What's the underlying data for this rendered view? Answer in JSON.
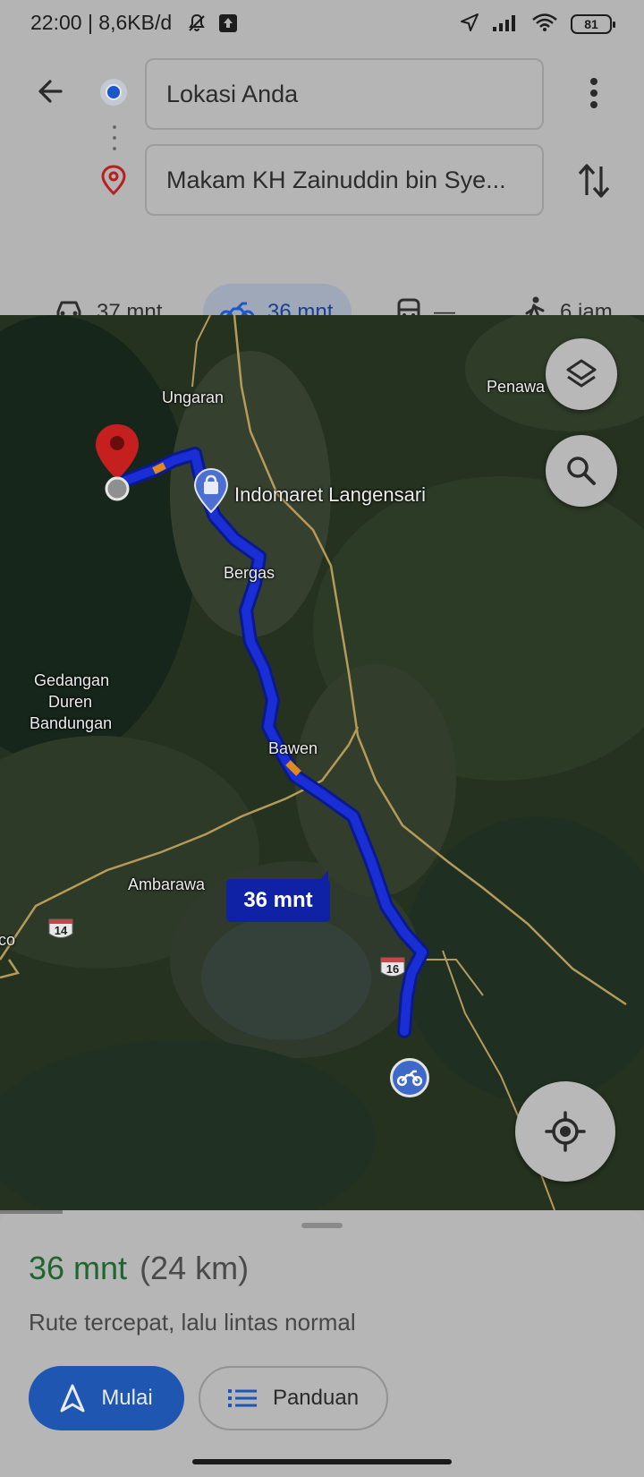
{
  "status_bar": {
    "time": "22:00 | 8,6KB/d",
    "battery": "81",
    "icons": [
      "mute-bell-icon",
      "upload-icon",
      "location-arrow-icon",
      "signal-icon",
      "wifi-icon",
      "battery-icon"
    ]
  },
  "directions": {
    "origin": "Lokasi Anda",
    "destination": "Makam KH Zainuddin bin Sye..."
  },
  "modes": [
    {
      "name": "car",
      "icon": "car-icon",
      "label": "37 mnt",
      "active": false
    },
    {
      "name": "motorcycle",
      "icon": "motorcycle-icon",
      "label": "36 mnt",
      "active": true
    },
    {
      "name": "transit",
      "icon": "train-icon",
      "label": "—",
      "active": false
    },
    {
      "name": "walk",
      "icon": "walking-icon",
      "label": "6 jam",
      "active": false
    }
  ],
  "map": {
    "labels": {
      "ungaran": "Ungaran",
      "penawa": "Penawa",
      "indomaret": "Indomaret Langensari",
      "bergas": "Bergas",
      "gedangan": "Gedangan",
      "duren": "Duren",
      "bandungan": "Bandungan",
      "bawen": "Bawen",
      "ambarawa": "Ambarawa",
      "edge": "co",
      "road14": "14",
      "road16": "16"
    },
    "route_badge": "36 mnt"
  },
  "summary": {
    "time": "36 mnt",
    "distance": "(24 km)",
    "description": "Rute tercepat, lalu lintas normal"
  },
  "actions": {
    "start": "Mulai",
    "steps": "Panduan"
  },
  "colors": {
    "route": "#1a2ed6",
    "accent_green": "#1f6530",
    "primary_button": "#1e56b1",
    "pin": "#c61f1f"
  }
}
